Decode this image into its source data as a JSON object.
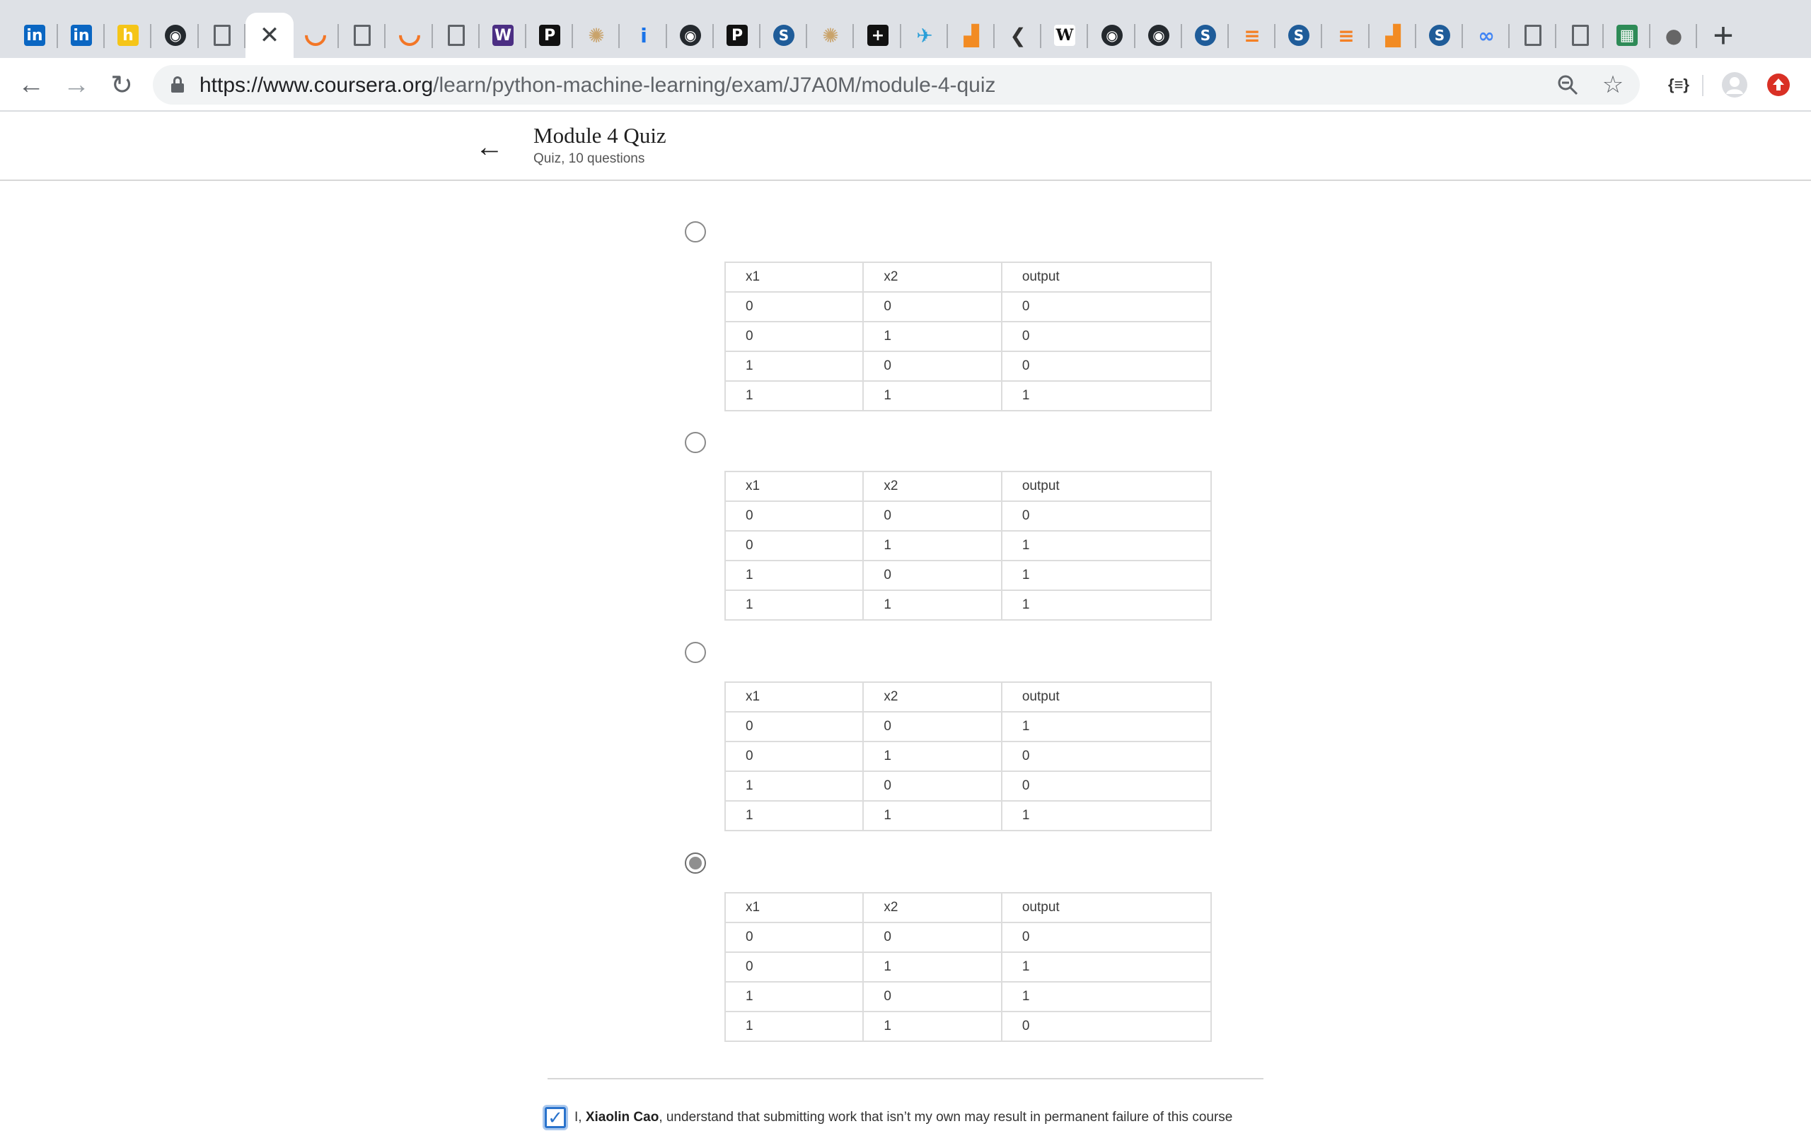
{
  "browser": {
    "tabs": [
      {
        "icon": "linkedin-icon",
        "glyph": "in",
        "color": "#0a66c2"
      },
      {
        "icon": "linkedin-icon",
        "glyph": "in",
        "color": "#0a66c2"
      },
      {
        "icon": "handshake-icon",
        "glyph": "h",
        "color": "#f5c518"
      },
      {
        "icon": "github-icon",
        "glyph": "◉",
        "color": "#24292e"
      },
      {
        "icon": "document-icon",
        "glyph": "",
        "color": "outline"
      },
      {
        "icon": "close-icon",
        "glyph": "✕",
        "color": "active"
      },
      {
        "icon": "jupyter-icon",
        "glyph": "",
        "color": "arc"
      },
      {
        "icon": "document-icon",
        "glyph": "",
        "color": "outline"
      },
      {
        "icon": "jupyter-icon",
        "glyph": "",
        "color": "arc"
      },
      {
        "icon": "document-icon",
        "glyph": "",
        "color": "outline"
      },
      {
        "icon": "w-icon",
        "glyph": "W",
        "color": "#4b2e83"
      },
      {
        "icon": "p-icon",
        "glyph": "P",
        "color": "#111111"
      },
      {
        "icon": "compass-icon",
        "glyph": "✺",
        "color": "#c9a36b"
      },
      {
        "icon": "info-icon",
        "glyph": "i",
        "color": "#1a73e8"
      },
      {
        "icon": "github-icon",
        "glyph": "◉",
        "color": "#24292e"
      },
      {
        "icon": "p-icon",
        "glyph": "P",
        "color": "#111111"
      },
      {
        "icon": "s-icon",
        "glyph": "S",
        "color": "#1f5c99"
      },
      {
        "icon": "compass-icon",
        "glyph": "✺",
        "color": "#c9a36b"
      },
      {
        "icon": "plus-box-icon",
        "glyph": "+",
        "color": "#111111"
      },
      {
        "icon": "bird-icon",
        "glyph": "✈",
        "color": "#2b9fd8"
      },
      {
        "icon": "chart-icon",
        "glyph": "▟",
        "color": "#f28b23"
      },
      {
        "icon": "c-icon",
        "glyph": "❮",
        "color": "#333333"
      },
      {
        "icon": "wikipedia-icon",
        "glyph": "W",
        "color": "#ffffff"
      },
      {
        "icon": "github-icon",
        "glyph": "◉",
        "color": "#24292e"
      },
      {
        "icon": "github-icon",
        "glyph": "◉",
        "color": "#24292e"
      },
      {
        "icon": "s-icon",
        "glyph": "S",
        "color": "#1f5c99"
      },
      {
        "icon": "stackoverflow-icon",
        "glyph": "≡",
        "color": "#f48024"
      },
      {
        "icon": "s-icon",
        "glyph": "S",
        "color": "#1f5c99"
      },
      {
        "icon": "stackoverflow-icon",
        "glyph": "≡",
        "color": "#f48024"
      },
      {
        "icon": "chart-icon",
        "glyph": "▟",
        "color": "#f28b23"
      },
      {
        "icon": "s-icon",
        "glyph": "S",
        "color": "#1f5c99"
      },
      {
        "icon": "infinity-icon",
        "glyph": "∞",
        "color": "#4285f4"
      },
      {
        "icon": "document-icon",
        "glyph": "",
        "color": "outline"
      },
      {
        "icon": "document-icon",
        "glyph": "",
        "color": "outline"
      },
      {
        "icon": "grid-icon",
        "glyph": "▦",
        "color": "#2e8b57"
      },
      {
        "icon": "apple-icon",
        "glyph": "●",
        "color": "#666666"
      }
    ],
    "new_tab": "+",
    "url_domain": "https://www.coursera.org",
    "url_path": "/learn/python-machine-learning/exam/J7A0M/module-4-quiz",
    "ext_json": "{≡}"
  },
  "header": {
    "title": "Module 4 Quiz",
    "subtitle": "Quiz, 10 questions"
  },
  "options": [
    {
      "selected": false,
      "headers": [
        "x1",
        "x2",
        "output"
      ],
      "rows": [
        [
          "0",
          "0",
          "0"
        ],
        [
          "0",
          "1",
          "0"
        ],
        [
          "1",
          "0",
          "0"
        ],
        [
          "1",
          "1",
          "1"
        ]
      ]
    },
    {
      "selected": false,
      "headers": [
        "x1",
        "x2",
        "output"
      ],
      "rows": [
        [
          "0",
          "0",
          "0"
        ],
        [
          "0",
          "1",
          "1"
        ],
        [
          "1",
          "0",
          "1"
        ],
        [
          "1",
          "1",
          "1"
        ]
      ]
    },
    {
      "selected": false,
      "headers": [
        "x1",
        "x2",
        "output"
      ],
      "rows": [
        [
          "0",
          "0",
          "1"
        ],
        [
          "0",
          "1",
          "0"
        ],
        [
          "1",
          "0",
          "0"
        ],
        [
          "1",
          "1",
          "1"
        ]
      ]
    },
    {
      "selected": true,
      "headers": [
        "x1",
        "x2",
        "output"
      ],
      "rows": [
        [
          "0",
          "0",
          "0"
        ],
        [
          "0",
          "1",
          "1"
        ],
        [
          "1",
          "0",
          "1"
        ],
        [
          "1",
          "1",
          "0"
        ]
      ]
    }
  ],
  "honor": {
    "checked": true,
    "prefix": "I, ",
    "name": "Xiaolin Cao",
    "suffix": ", understand that submitting work that isn’t my own may result in permanent failure of this course"
  },
  "colors": {
    "accent": "#2a73cc",
    "tabstrip": "#dee1e6",
    "profile_badge": "#d93025"
  }
}
